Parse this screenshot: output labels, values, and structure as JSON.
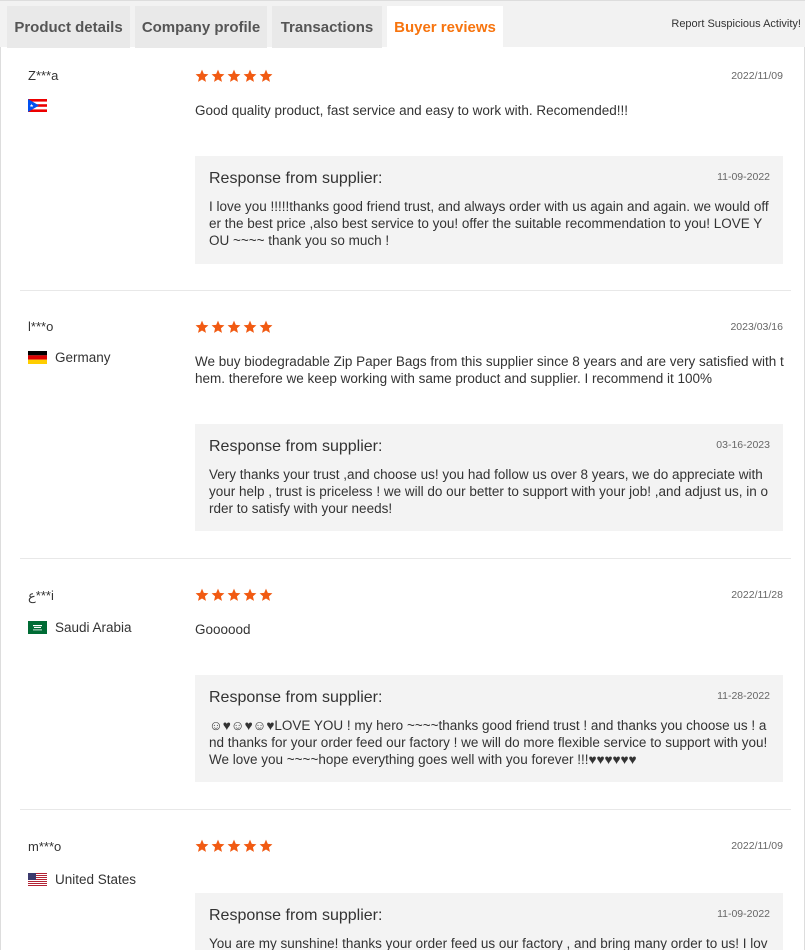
{
  "tabs": [
    {
      "label": "Product details"
    },
    {
      "label": "Company profile"
    },
    {
      "label": "Transactions"
    },
    {
      "label": "Buyer reviews"
    }
  ],
  "report_link": "Report Suspicious Activity!",
  "colors": {
    "accent": "#f7740e",
    "star": "#f15a12"
  },
  "reviews": [
    {
      "user": "Z***a",
      "country": "",
      "flag": "puerto-rico",
      "rating": 5,
      "date": "2022/11/09",
      "text": "Good quality product, fast service and easy to work with. Recomended!!!",
      "response": {
        "title": "Response from supplier:",
        "date": "11-09-2022",
        "text": "I love you !!!!!thanks good friend trust, and always order with us again and again. we would offer the best price ,also best service to you! offer the suitable recommendation to you! LOVE YOU ~~~~ thank you so much !"
      }
    },
    {
      "user": "l***o",
      "country": "Germany",
      "flag": "germany",
      "rating": 5,
      "date": "2023/03/16",
      "text": "We buy biodegradable Zip Paper Bags from this supplier since 8 years and are very satisfied with them. therefore we keep working with same product and supplier. I recommend it 100%",
      "response": {
        "title": "Response from supplier:",
        "date": "03-16-2023",
        "text": "Very thanks your trust ,and choose us! you had follow us over 8 years, we do appreciate with your help , trust is priceless !  we will do our better to support with your job! ,and adjust us, in order to satisfy with your needs!"
      }
    },
    {
      "user": "ع***i",
      "country": "Saudi Arabia",
      "flag": "saudi-arabia",
      "rating": 5,
      "date": "2022/11/28",
      "text": "Goooood",
      "response": {
        "title": "Response from supplier:",
        "date": "11-28-2022",
        "text": "☺♥☺♥☺♥LOVE YOU ! my hero ~~~~thanks good friend trust ! and thanks you choose us ! and thanks for your order feed our factory ! we will do more flexible service to support with you! We love you ~~~~hope everything goes well with you forever !!!♥♥♥♥♥♥"
      }
    },
    {
      "user": "m***o",
      "country": "United States",
      "flag": "united-states",
      "rating": 5,
      "date": "2022/11/09",
      "text": "",
      "response": {
        "title": "Response from supplier:",
        "date": "11-09-2022",
        "text": "You are my sunshine! thanks your order feed us our factory , and bring many order to us! I love you"
      }
    }
  ]
}
